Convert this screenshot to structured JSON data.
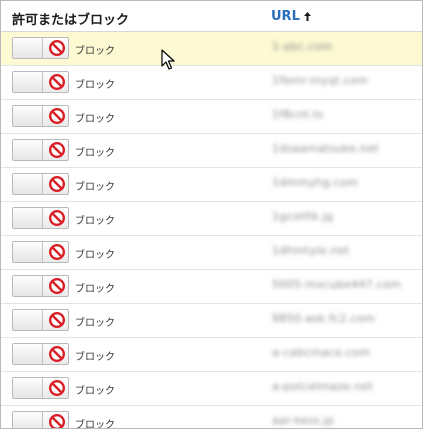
{
  "header": {
    "action_label": "許可またはブロック",
    "url_label": "URL",
    "sort_icon": "sort-ascending-arrow-icon"
  },
  "colors": {
    "accent_link": "#2a6ebb",
    "highlight_row": "#fdf9d3",
    "block_icon": "#d81f26"
  },
  "rows": [
    {
      "action": "ブロック",
      "url": "1-abc.com"
    },
    {
      "action": "ブロック",
      "url": "1fbmr-myqt.com"
    },
    {
      "action": "ブロック",
      "url": "1f8cnt.ts"
    },
    {
      "action": "ブロック",
      "url": "1dsaamatsuke.net"
    },
    {
      "action": "ブロック",
      "url": "1dmmyhg.com"
    },
    {
      "action": "ブロック",
      "url": "1gcotfik.jg"
    },
    {
      "action": "ブロック",
      "url": "1dhmtyle.net"
    },
    {
      "action": "ブロック",
      "url": "5005-mxcube447.com"
    },
    {
      "action": "ブロック",
      "url": "9850-ask.fc2.com"
    },
    {
      "action": "ブロック",
      "url": "a-cabcmace.com"
    },
    {
      "action": "ブロック",
      "url": "a-potcelmaze.net"
    },
    {
      "action": "ブロック",
      "url": "aar-kess.jp"
    }
  ]
}
